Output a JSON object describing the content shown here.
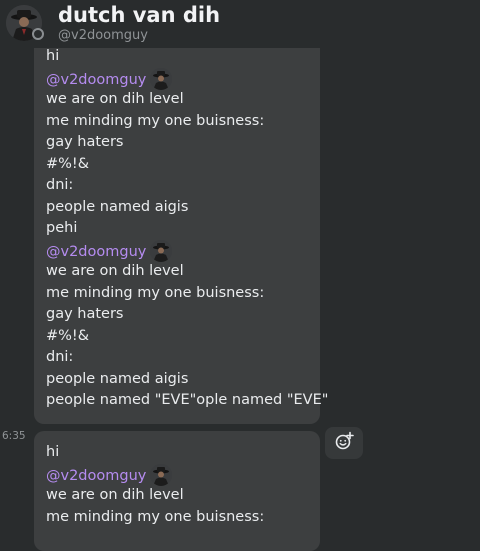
{
  "header": {
    "title": "dutch van dih",
    "handle": "@v2doomguy"
  },
  "messages": [
    {
      "lines": [
        {
          "kind": "text",
          "text": "hi"
        },
        {
          "kind": "mention",
          "text": "@v2doomguy"
        },
        {
          "kind": "text",
          "text": "we are on dih level"
        },
        {
          "kind": "text",
          "text": "me minding my one buisness:"
        },
        {
          "kind": "text",
          "text": "gay haters"
        },
        {
          "kind": "text",
          "text": "#%!&"
        },
        {
          "kind": "text",
          "text": "dni:"
        },
        {
          "kind": "text",
          "text": "people named aigis"
        },
        {
          "kind": "text",
          "text": "pehi"
        },
        {
          "kind": "mention",
          "text": "@v2doomguy"
        },
        {
          "kind": "text",
          "text": "we are on dih level"
        },
        {
          "kind": "text",
          "text": "me minding my one buisness:"
        },
        {
          "kind": "text",
          "text": "gay haters"
        },
        {
          "kind": "text",
          "text": "#%!&"
        },
        {
          "kind": "text",
          "text": "dni:"
        },
        {
          "kind": "text",
          "text": "people named aigis"
        },
        {
          "kind": "text",
          "text": "people named \"EVE\"ople named \"EVE\""
        }
      ]
    },
    {
      "timestamp": "6:35",
      "lines": [
        {
          "kind": "text",
          "text": "hi"
        },
        {
          "kind": "mention",
          "text": "@v2doomguy"
        },
        {
          "kind": "text",
          "text": "we are on dih level"
        },
        {
          "kind": "text",
          "text": "me minding my one buisness:"
        }
      ]
    }
  ],
  "icons": {
    "react": "add-reaction-icon",
    "status": "status-offline-icon",
    "avatar": "user-avatar"
  },
  "colors": {
    "background": "#292c2d",
    "bubble": "#3d3f40",
    "mention": "#b58cf0",
    "text": "#eaecee",
    "muted": "#8f9396"
  }
}
